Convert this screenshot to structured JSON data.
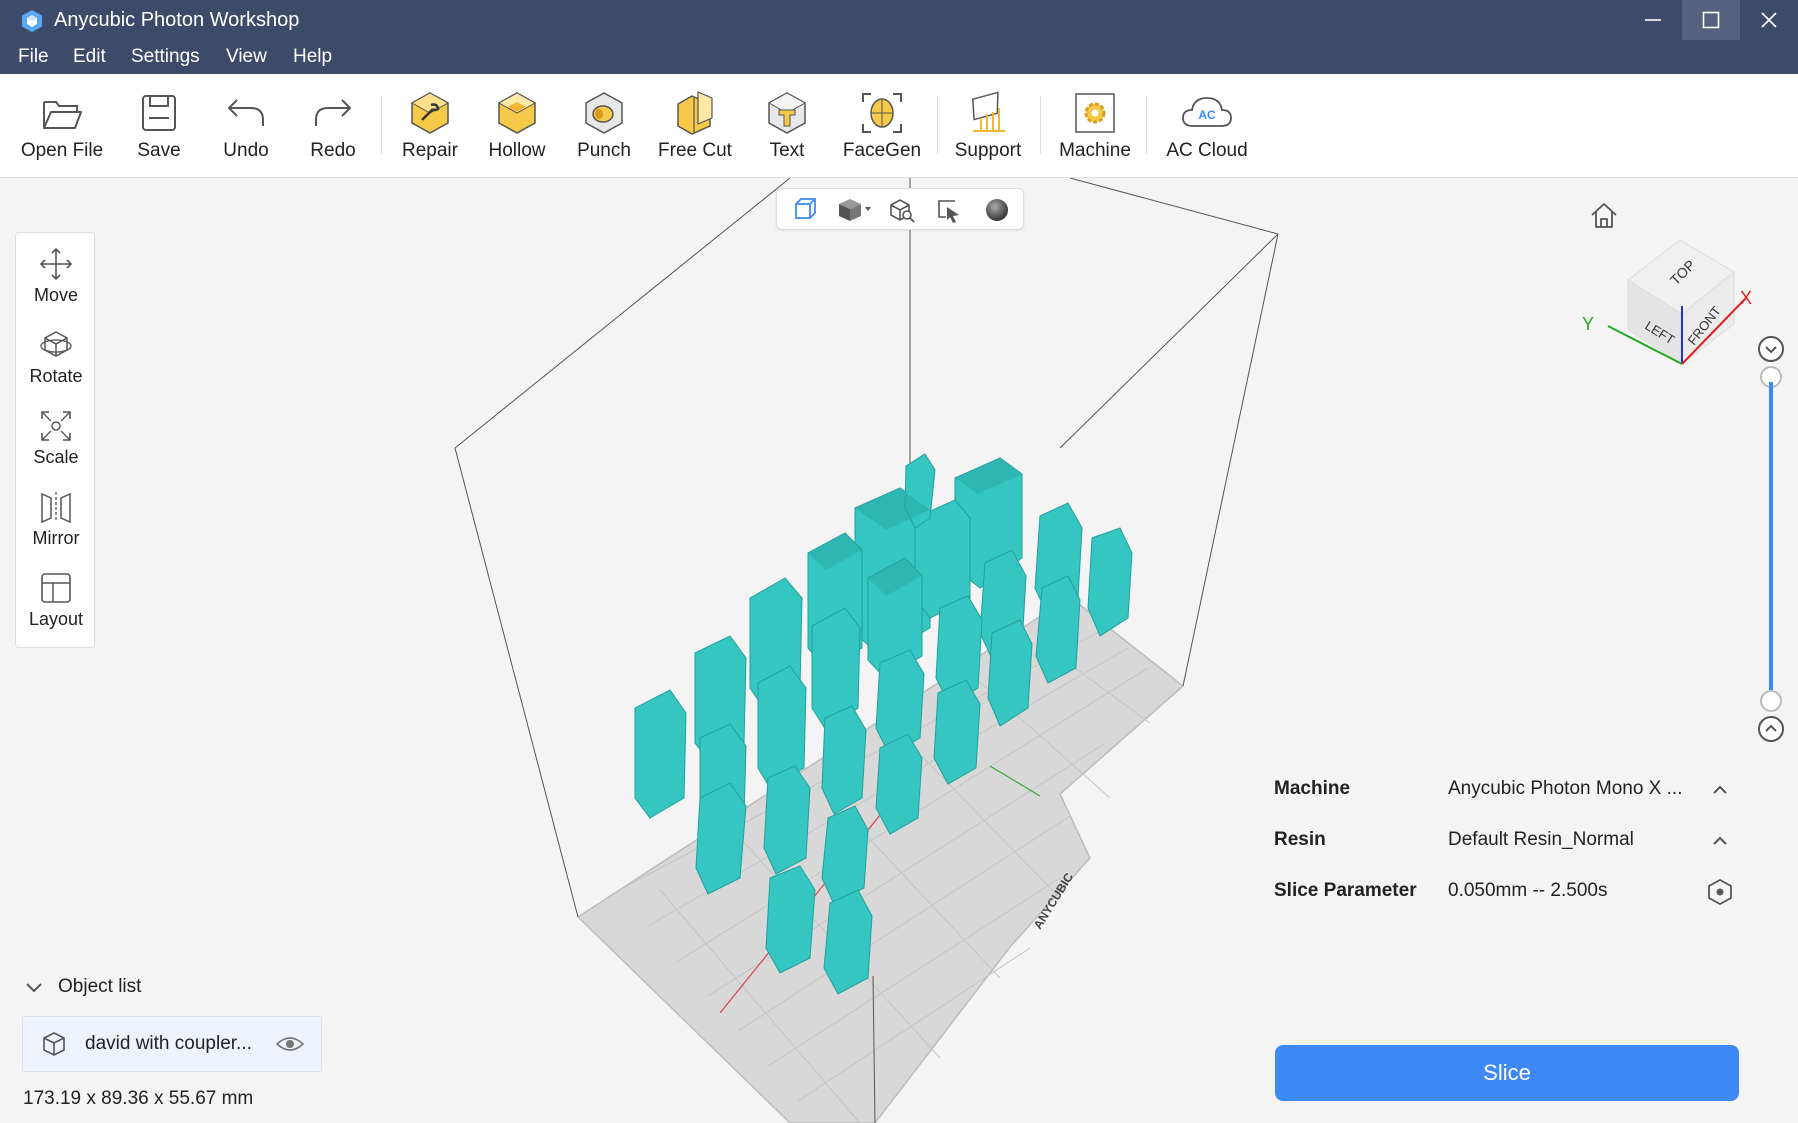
{
  "window": {
    "title": "Anycubic Photon Workshop",
    "controls": [
      "minimize-icon",
      "maximize-icon",
      "close-icon"
    ]
  },
  "menu": [
    "File",
    "Edit",
    "Settings",
    "View",
    "Help"
  ],
  "toolbar": {
    "open_file": "Open File",
    "save": "Save",
    "undo": "Undo",
    "redo": "Redo",
    "repair": "Repair",
    "hollow": "Hollow",
    "punch": "Punch",
    "free_cut": "Free Cut",
    "text": "Text",
    "facegen": "FaceGen",
    "support": "Support",
    "machine": "Machine",
    "ac_cloud": "AC Cloud"
  },
  "view_toolbar": [
    "wireframe-box-icon",
    "solid-cube-icon",
    "zoom-box-icon",
    "select-icon",
    "sphere-icon"
  ],
  "left_tools": {
    "move": "Move",
    "rotate": "Rotate",
    "scale": "Scale",
    "mirror": "Mirror",
    "layout": "Layout"
  },
  "view_cube": {
    "top": "TOP",
    "left": "LEFT",
    "front": "FRONT",
    "axis_x": "X",
    "axis_y": "Y"
  },
  "build_plate_logo": "ANYCUBIC",
  "object_list": {
    "header": "Object list",
    "items": [
      {
        "name": "david with coupler..."
      }
    ],
    "dimensions": "173.19 x 89.36 x 55.67 mm"
  },
  "properties": {
    "machine_label": "Machine",
    "machine_value": "Anycubic Photon Mono X ...",
    "resin_label": "Resin",
    "resin_value": "Default Resin_Normal",
    "slice_param_label": "Slice Parameter",
    "slice_param_value": "0.050mm -- 2.500s"
  },
  "slice_button": "Slice",
  "colors": {
    "titlebar": "#3c4b69",
    "accent": "#3d8af7",
    "model": "#35c6c2",
    "plate": "#d9d9d9"
  }
}
